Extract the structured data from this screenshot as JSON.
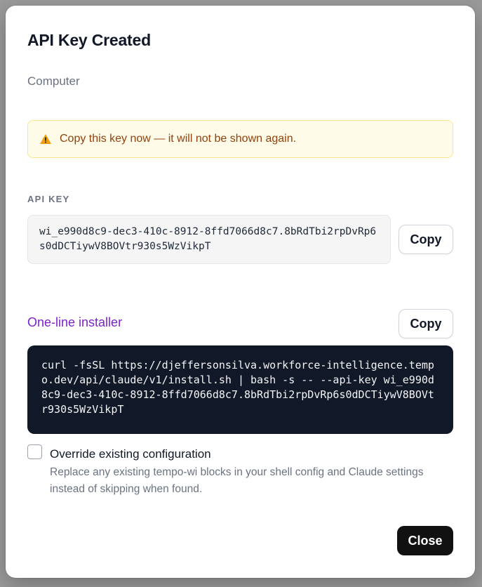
{
  "dialog": {
    "title": "API Key Created",
    "subtitle": "Computer"
  },
  "warning": {
    "icon": "warning-icon",
    "text": "Copy this key now — it will not be shown again.",
    "color": "#92400e"
  },
  "api_key": {
    "label": "API KEY",
    "value": "wi_e990d8c9-dec3-410c-8912-8ffd7066d8c7.8bRdTbi2rpDvRp6s0dDCTiywV8BOVtr930s5WzVikpT",
    "copy_label": "Copy"
  },
  "installer": {
    "label": "One-line installer",
    "label_color": "#7e22ce",
    "copy_label": "Copy",
    "command": "curl -fsSL https://djeffersonsilva.workforce-intelligence.tempo.dev/api/claude/v1/install.sh | bash -s -- --api-key wi_e990d8c9-dec3-410c-8912-8ffd7066d8c7.8bRdTbi2rpDvRp6s0dDCTiywV8BOVtr930s5WzVikpT"
  },
  "override": {
    "checked": false,
    "label": "Override existing configuration",
    "description": "Replace any existing tempo-wi blocks in your shell config and Claude settings instead of skipping when found."
  },
  "footer": {
    "close_label": "Close"
  }
}
